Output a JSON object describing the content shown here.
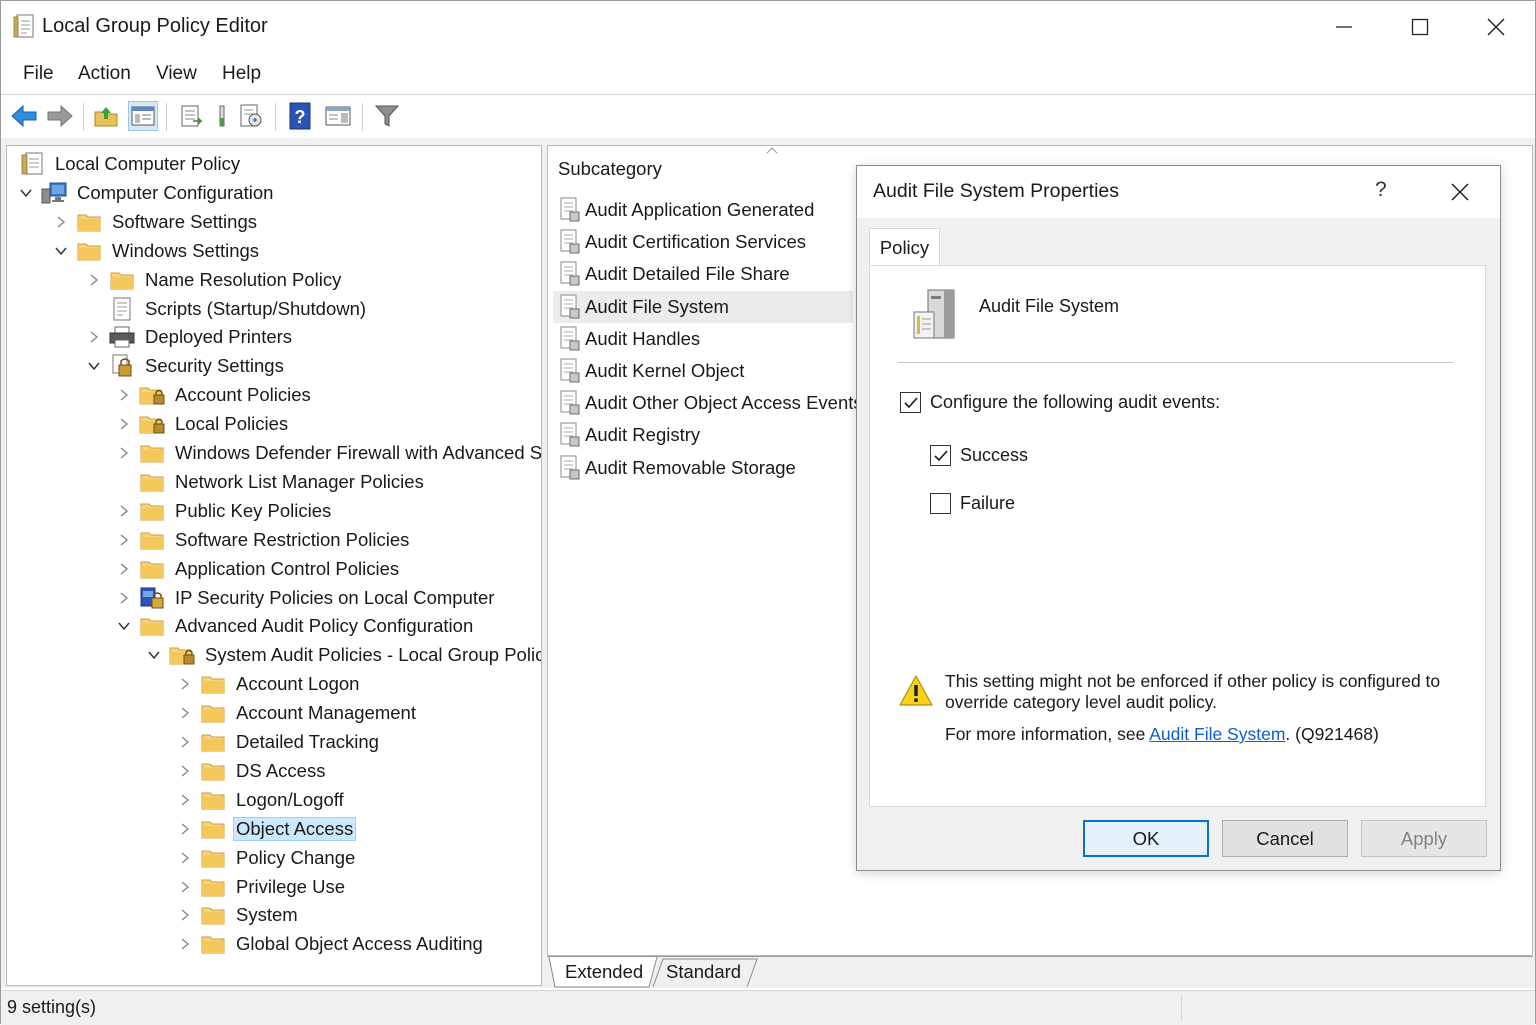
{
  "window": {
    "title": "Local Group Policy Editor"
  },
  "menu": [
    "File",
    "Action",
    "View",
    "Help"
  ],
  "tree": [
    {
      "label": "Local Computer Policy",
      "level": 0,
      "icon": "policy-doc-icon",
      "expander": "none"
    },
    {
      "label": "Computer Configuration",
      "level": 0,
      "icon": "computer-icon",
      "expander": "expanded"
    },
    {
      "label": "Software Settings",
      "level": 1,
      "icon": "folder-icon",
      "expander": "collapsed"
    },
    {
      "label": "Windows Settings",
      "level": 1,
      "icon": "folder-icon",
      "expander": "expanded"
    },
    {
      "label": "Name Resolution Policy",
      "level": 2,
      "icon": "folder-icon",
      "expander": "collapsed"
    },
    {
      "label": "Scripts (Startup/Shutdown)",
      "level": 2,
      "icon": "script-icon",
      "expander": "none"
    },
    {
      "label": "Deployed Printers",
      "level": 2,
      "icon": "printer-icon",
      "expander": "collapsed"
    },
    {
      "label": "Security Settings",
      "level": 2,
      "icon": "security-icon",
      "expander": "expanded"
    },
    {
      "label": "Account Policies",
      "level": 3,
      "icon": "folder-lock-icon",
      "expander": "collapsed"
    },
    {
      "label": "Local Policies",
      "level": 3,
      "icon": "folder-lock-icon",
      "expander": "collapsed"
    },
    {
      "label": "Windows Defender Firewall with Advanced Security",
      "level": 3,
      "icon": "folder-icon",
      "expander": "collapsed"
    },
    {
      "label": "Network List Manager Policies",
      "level": 3,
      "icon": "folder-icon",
      "expander": "none"
    },
    {
      "label": "Public Key Policies",
      "level": 3,
      "icon": "folder-icon",
      "expander": "collapsed"
    },
    {
      "label": "Software Restriction Policies",
      "level": 3,
      "icon": "folder-icon",
      "expander": "collapsed"
    },
    {
      "label": "Application Control Policies",
      "level": 3,
      "icon": "folder-icon",
      "expander": "collapsed"
    },
    {
      "label": "IP Security Policies on Local Computer",
      "level": 3,
      "icon": "ip-security-icon",
      "expander": "collapsed"
    },
    {
      "label": "Advanced Audit Policy Configuration",
      "level": 3,
      "icon": "folder-icon",
      "expander": "expanded"
    },
    {
      "label": "System Audit Policies - Local Group Policy",
      "level": 4,
      "icon": "folder-lock-icon",
      "expander": "expanded"
    },
    {
      "label": "Account Logon",
      "level": 5,
      "icon": "folder-icon",
      "expander": "collapsed"
    },
    {
      "label": "Account Management",
      "level": 5,
      "icon": "folder-icon",
      "expander": "collapsed"
    },
    {
      "label": "Detailed Tracking",
      "level": 5,
      "icon": "folder-icon",
      "expander": "collapsed"
    },
    {
      "label": "DS Access",
      "level": 5,
      "icon": "folder-icon",
      "expander": "collapsed"
    },
    {
      "label": "Logon/Logoff",
      "level": 5,
      "icon": "folder-icon",
      "expander": "collapsed"
    },
    {
      "label": "Object Access",
      "level": 5,
      "icon": "folder-icon",
      "expander": "collapsed",
      "selected": true
    },
    {
      "label": "Policy Change",
      "level": 5,
      "icon": "folder-icon",
      "expander": "collapsed"
    },
    {
      "label": "Privilege Use",
      "level": 5,
      "icon": "folder-icon",
      "expander": "collapsed"
    },
    {
      "label": "System",
      "level": 5,
      "icon": "folder-icon",
      "expander": "collapsed"
    },
    {
      "label": "Global Object Access Auditing",
      "level": 5,
      "icon": "folder-icon",
      "expander": "collapsed"
    }
  ],
  "list": {
    "header": "Subcategory",
    "rows": [
      {
        "label": "Audit Application Generated"
      },
      {
        "label": "Audit Certification Services"
      },
      {
        "label": "Audit Detailed File Share"
      },
      {
        "label": "Audit File System",
        "selected": true
      },
      {
        "label": "Audit Handles"
      },
      {
        "label": "Audit Kernel Object"
      },
      {
        "label": "Audit Other Object Access Events"
      },
      {
        "label": "Audit Registry"
      },
      {
        "label": "Audit Removable Storage"
      }
    ]
  },
  "bottom_tabs": [
    "Extended",
    "Standard"
  ],
  "status": {
    "text": "9 setting(s)"
  },
  "dialog": {
    "title": "Audit File System Properties",
    "help": "?",
    "tab": "Policy",
    "policy_name": "Audit File System",
    "configure_label": "Configure the following audit events:",
    "configure_checked": true,
    "success_label": "Success",
    "success_checked": true,
    "failure_label": "Failure",
    "failure_checked": false,
    "warning": "This setting might not be enforced if other policy is configured to override category level audit policy.",
    "more_info_prefix": "For more information, see ",
    "more_info_link": "Audit File System",
    "more_info_suffix": ". (Q921468)",
    "buttons": {
      "ok": "OK",
      "cancel": "Cancel",
      "apply": "Apply"
    }
  },
  "colors": {
    "selection": "#cce8ff",
    "link": "#0a5ed7",
    "folder": "#f3c75a",
    "primary_border": "#0a70d1"
  }
}
